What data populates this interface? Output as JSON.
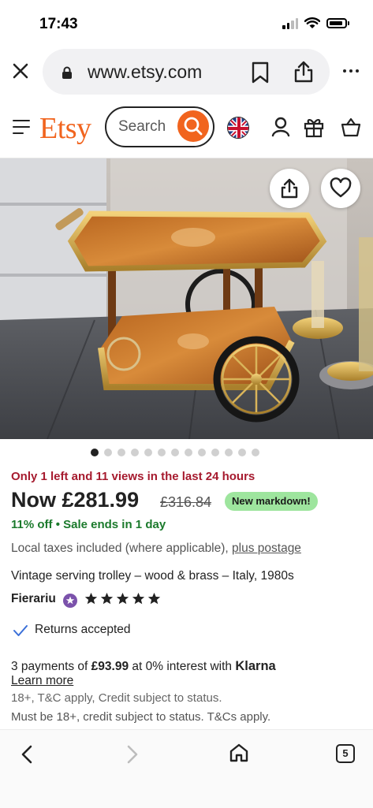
{
  "status_bar": {
    "time": "17:43",
    "icons": [
      "signal-icon",
      "wifi-icon",
      "battery-icon"
    ]
  },
  "browser": {
    "url": "www.etsy.com",
    "icons": [
      "close-icon",
      "lock-icon",
      "bookmark-icon",
      "share-icon",
      "more-icon"
    ]
  },
  "header": {
    "logo": "Etsy",
    "search_placeholder": "Search",
    "icons": [
      "menu-icon",
      "search-icon",
      "uk-flag-icon",
      "user-icon",
      "gift-icon",
      "basket-icon"
    ]
  },
  "gallery": {
    "image_count": 13,
    "active_index": 0,
    "icons": [
      "share-icon",
      "heart-icon"
    ]
  },
  "product": {
    "scarcity": "Only 1 left and 11 views in the last 24 hours",
    "price": "Now £281.99",
    "original_price": "£316.84",
    "markdown_badge": "New markdown!",
    "discount": "11% off",
    "sale_end": "Sale ends in 1 day",
    "taxes_text": "Local taxes included (where applicable),",
    "postage_link": "plus postage",
    "title": "Vintage serving trolley – wood & brass – Italy, 1980s",
    "seller": "Fierariu",
    "rating_stars": 5,
    "returns": "Returns accepted"
  },
  "klarna": {
    "prefix": "3 payments of",
    "amount": "£93.99",
    "mid": "at 0% interest with",
    "brand": "Klarna",
    "learn_more": "Learn more",
    "fine_print_1": "18+, T&C apply, Credit subject to status.",
    "fine_print_2": "Must be 18+, credit subject to status. T&Cs apply."
  },
  "bottom_nav": {
    "tab_count": "5",
    "icons": [
      "back-icon",
      "forward-icon",
      "home-icon",
      "tabs-icon"
    ]
  },
  "colors": {
    "brand": "#f1641e",
    "scarcity": "#a61a2e",
    "sale_green": "#1b7a2c",
    "badge_green": "#9ee59e",
    "star_seller": "#7b52ab"
  }
}
